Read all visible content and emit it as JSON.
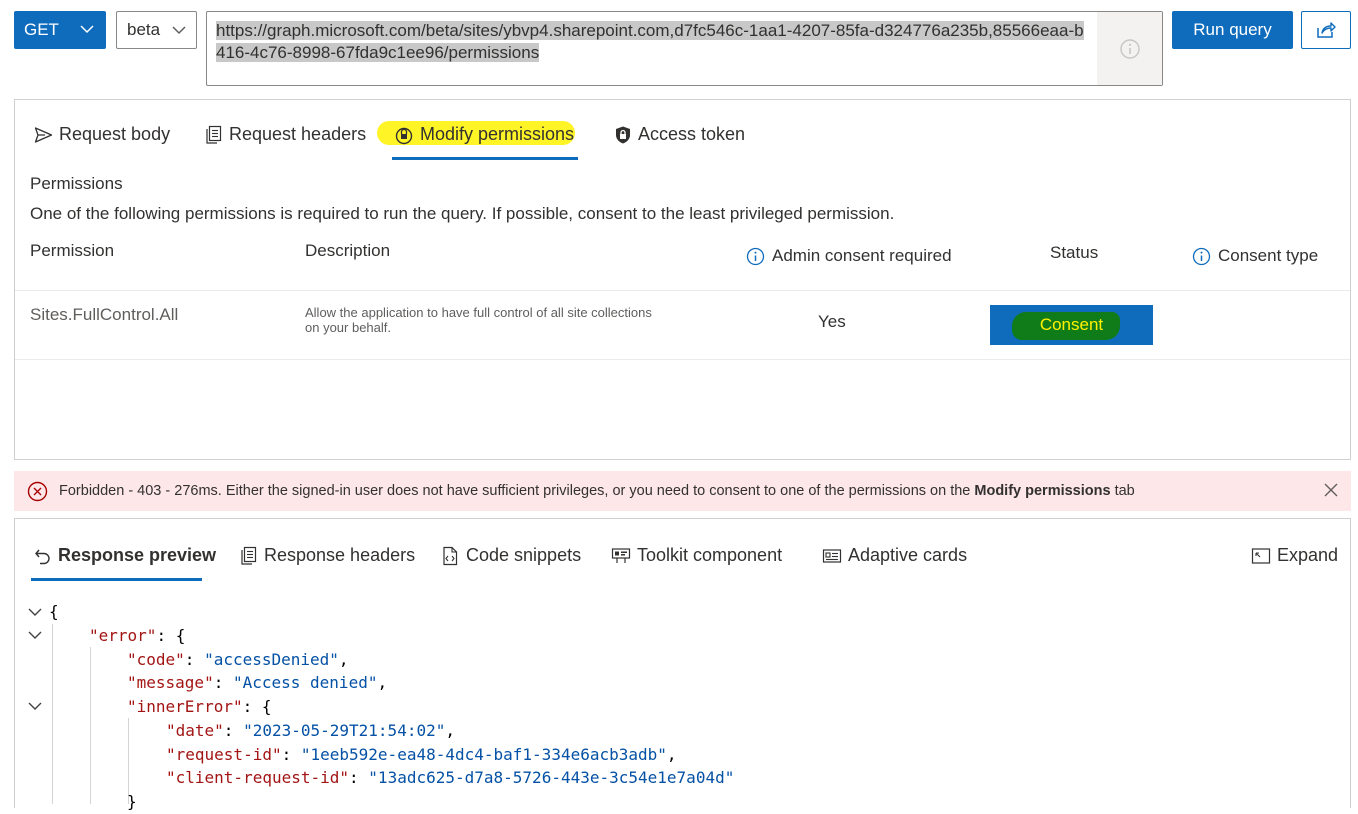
{
  "query": {
    "method": "GET",
    "version": "beta",
    "url": "https://graph.microsoft.com/beta/sites/ybvp4.sharepoint.com,d7fc546c-1aa1-4207-85fa-d324776a235b,85566eaa-b416-4c76-8998-67fda9c1ee96/permissions",
    "run_label": "Run query"
  },
  "request_tabs": [
    {
      "label": "Request body",
      "icon": "send-icon"
    },
    {
      "label": "Request headers",
      "icon": "document-icon"
    },
    {
      "label": "Modify permissions",
      "icon": "lock-icon",
      "active": true
    },
    {
      "label": "Access token",
      "icon": "shield-lock-icon"
    }
  ],
  "permissions": {
    "title": "Permissions",
    "subtitle": "One of the following permissions is required to run the query. If possible, consent to the least privileged permission.",
    "columns": [
      "Permission",
      "Description",
      "Admin consent required",
      "Status",
      "Consent type"
    ],
    "rows": [
      {
        "permission": "Sites.FullControl.All",
        "description": "Allow the application to have full control of all site collections on your behalf.",
        "admin_consent": "Yes",
        "status_button": "Consent"
      }
    ]
  },
  "error": {
    "prefix": "Forbidden - 403 - 276ms. Either the signed-in user does not have sufficient privileges, or you need to consent to one of the permissions on the ",
    "bold": "Modify permissions",
    "suffix": " tab"
  },
  "response_tabs": [
    {
      "label": "Response preview",
      "icon": "undo-icon",
      "active": true
    },
    {
      "label": "Response headers",
      "icon": "document-icon"
    },
    {
      "label": "Code snippets",
      "icon": "code-file-icon"
    },
    {
      "label": "Toolkit component",
      "icon": "toolkit-icon"
    },
    {
      "label": "Adaptive cards",
      "icon": "card-icon"
    }
  ],
  "expand_label": "Expand",
  "response": {
    "open_brace": "{",
    "error_key": "\"error\"",
    "code_key": "\"code\"",
    "code_val": "\"accessDenied\"",
    "message_key": "\"message\"",
    "message_val": "\"Access denied\"",
    "inner_key": "\"innerError\"",
    "date_key": "\"date\"",
    "date_val": "\"2023-05-29T21:54:02\"",
    "reqid_key": "\"request-id\"",
    "reqid_val": "\"1eeb592e-ea48-4dc4-baf1-334e6acb3adb\"",
    "clientid_key": "\"client-request-id\"",
    "clientid_val": "\"13adc625-d7a8-5726-443e-3c54e1e7a04d\"",
    "close_brace": "}"
  },
  "colors": {
    "accent": "#0f6cbd",
    "error_bg": "#fde7e9",
    "json_key": "#a31515",
    "json_string": "#0451a5"
  }
}
